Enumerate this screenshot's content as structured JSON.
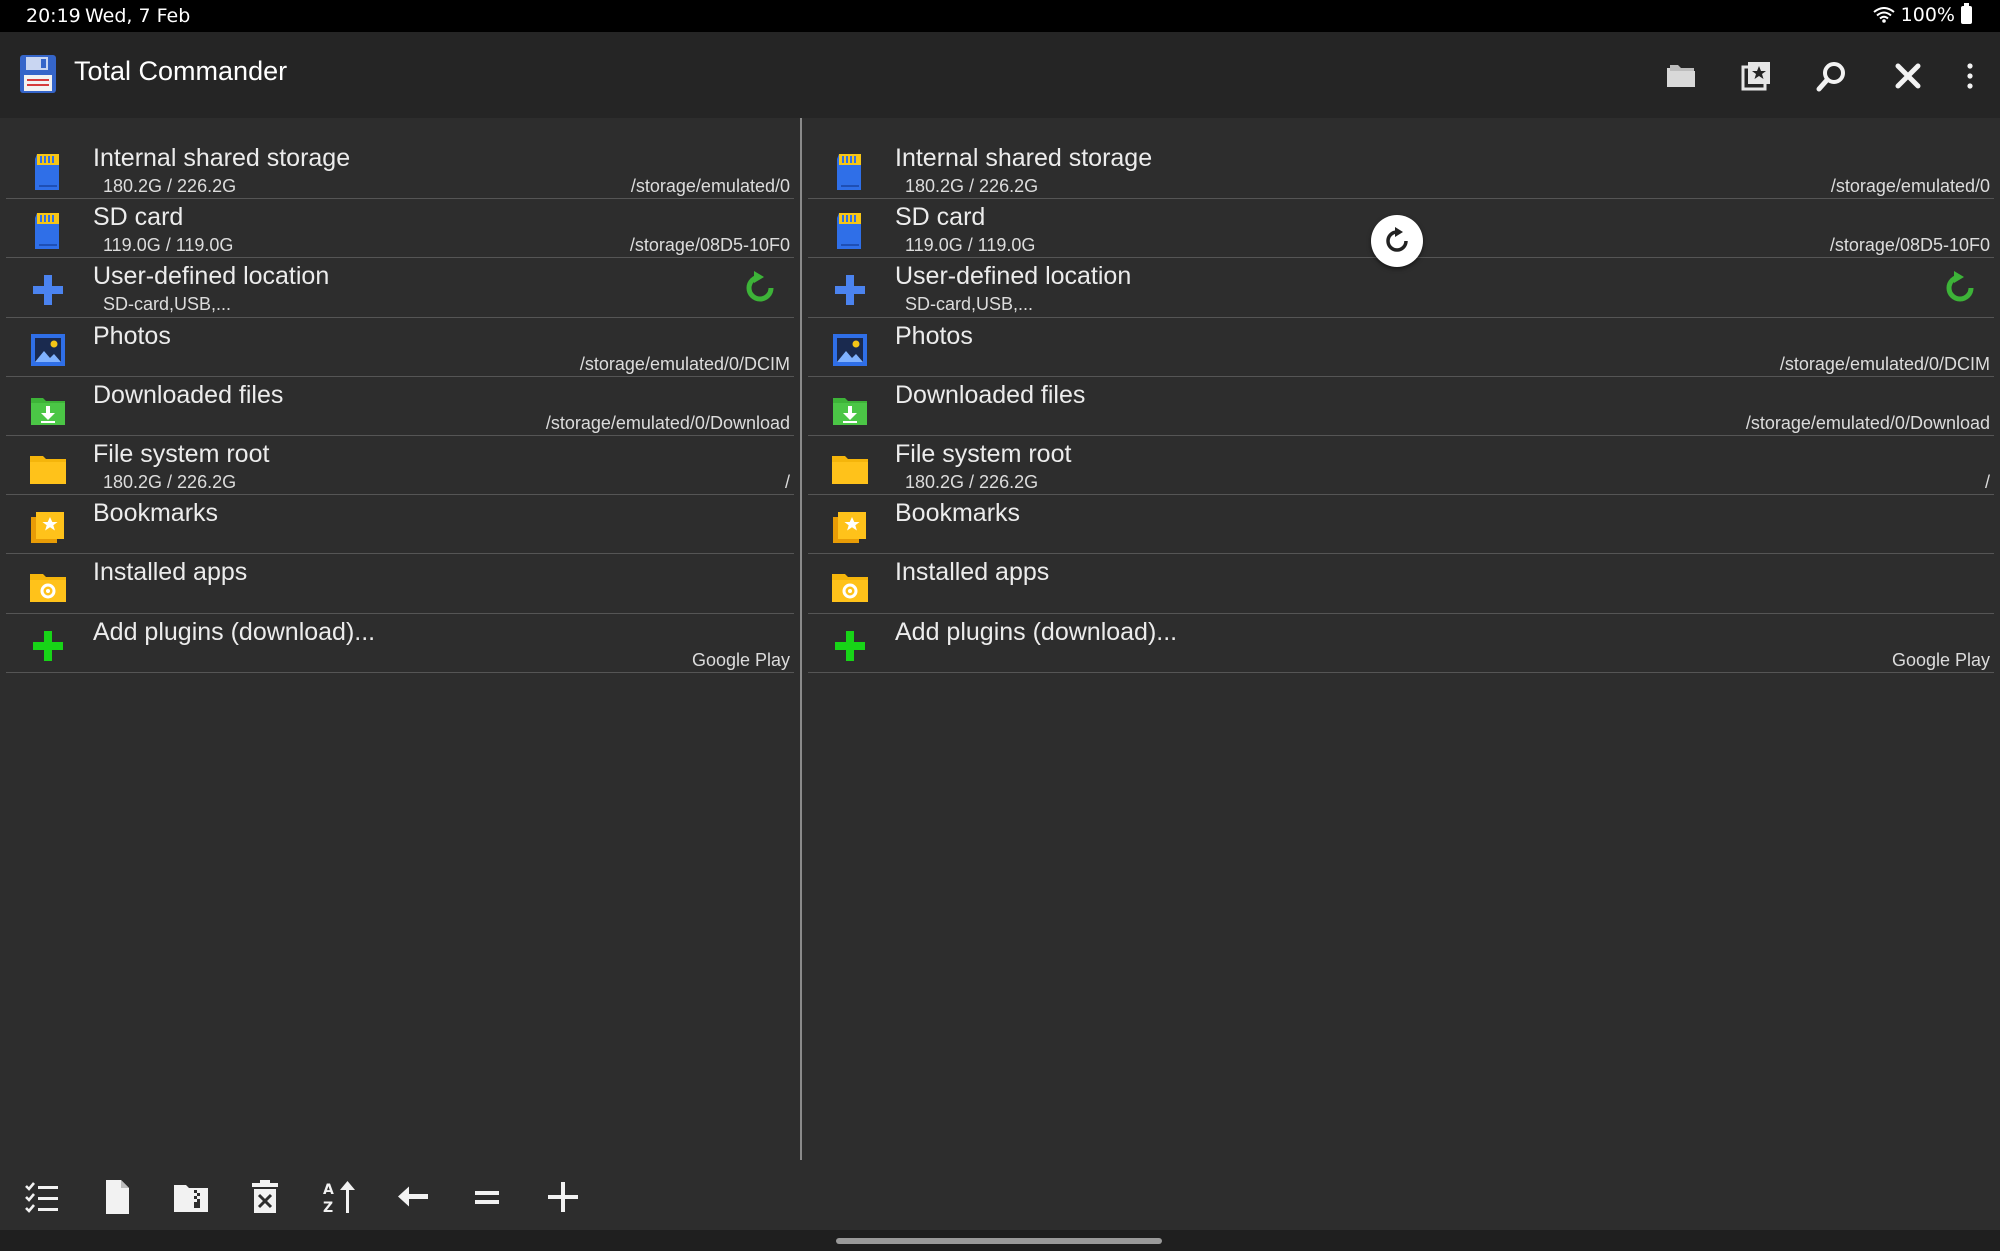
{
  "status_bar": {
    "time": "20:19",
    "date": "Wed, 7 Feb",
    "battery": "100%"
  },
  "app": {
    "title": "Total Commander"
  },
  "toolbar": {
    "folder_icon": "folder-icon",
    "bookmark_icon": "bookmark-star-icon",
    "search_icon": "search-icon",
    "close_icon": "close-icon",
    "overflow_icon": "overflow-menu-icon"
  },
  "left_panel": {
    "items": [
      {
        "title": "Internal shared storage",
        "sub": "180.2G / 226.2G",
        "path": "/storage/emulated/0",
        "icon": "sd-card-icon"
      },
      {
        "title": "SD card",
        "sub": "119.0G / 119.0G",
        "path": "/storage/08D5-10F0",
        "icon": "sd-card-icon"
      },
      {
        "title": "User-defined location",
        "sub": "SD-card,USB,...",
        "path": "",
        "icon": "plus-icon"
      },
      {
        "title": "Photos",
        "sub": "",
        "path": "/storage/emulated/0/DCIM",
        "icon": "photo-icon"
      },
      {
        "title": "Downloaded files",
        "sub": "",
        "path": "/storage/emulated/0/Download",
        "icon": "download-folder-icon"
      },
      {
        "title": "File system root",
        "sub": "180.2G / 226.2G",
        "path": "/",
        "icon": "folder-icon"
      },
      {
        "title": "Bookmarks",
        "sub": "",
        "path": "",
        "icon": "bookmarks-folder-icon"
      },
      {
        "title": "Installed apps",
        "sub": "",
        "path": "",
        "icon": "apps-folder-icon"
      },
      {
        "title": "Add plugins (download)...",
        "sub": "",
        "path": "Google Play",
        "icon": "add-plugin-icon"
      }
    ]
  },
  "right_panel": {
    "items": [
      {
        "title": "Internal shared storage",
        "sub": "180.2G / 226.2G",
        "path": "/storage/emulated/0",
        "icon": "sd-card-icon"
      },
      {
        "title": "SD card",
        "sub": "119.0G / 119.0G",
        "path": "/storage/08D5-10F0",
        "icon": "sd-card-icon"
      },
      {
        "title": "User-defined location",
        "sub": "SD-card,USB,...",
        "path": "",
        "icon": "plus-icon"
      },
      {
        "title": "Photos",
        "sub": "",
        "path": "/storage/emulated/0/DCIM",
        "icon": "photo-icon"
      },
      {
        "title": "Downloaded files",
        "sub": "",
        "path": "/storage/emulated/0/Download",
        "icon": "download-folder-icon"
      },
      {
        "title": "File system root",
        "sub": "180.2G / 226.2G",
        "path": "/",
        "icon": "folder-icon"
      },
      {
        "title": "Bookmarks",
        "sub": "",
        "path": "",
        "icon": "bookmarks-folder-icon"
      },
      {
        "title": "Installed apps",
        "sub": "",
        "path": "",
        "icon": "apps-folder-icon"
      },
      {
        "title": "Add plugins (download)...",
        "sub": "",
        "path": "Google Play",
        "icon": "add-plugin-icon"
      }
    ]
  },
  "bottom_toolbar": {
    "buttons": [
      "select-list-icon",
      "new-file-icon",
      "zip-folder-icon",
      "delete-icon",
      "sort-icon",
      "back-arrow-icon",
      "equal-panels-icon",
      "plus-icon"
    ]
  },
  "colors": {
    "background": "#2d2d2d",
    "appbar": "#252525",
    "accent_blue": "#2f6fe8",
    "folder_yellow": "#f5b50b",
    "green": "#3db338"
  }
}
